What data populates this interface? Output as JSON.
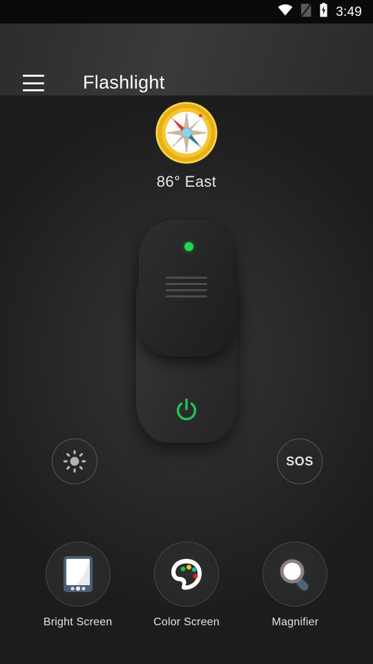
{
  "status_bar": {
    "time": "3:49",
    "icons": [
      {
        "name": "wifi-icon",
        "label": "wifi"
      },
      {
        "name": "no-sim-icon",
        "label": "no sim"
      },
      {
        "name": "battery-charging-icon",
        "label": "battery charging"
      }
    ]
  },
  "app_bar": {
    "menu_icon": "hamburger-menu-icon",
    "title": "Flashlight"
  },
  "compass": {
    "icon": "compass-icon",
    "heading_label": "86° East",
    "degrees": 86,
    "direction": "East",
    "ring_color": "#f2c230",
    "needle_north_color": "#e03a32",
    "needle_south_color": "#2d7f8c",
    "hub_color": "#8fd3e8",
    "star_color": "#c9b79c"
  },
  "flashlight": {
    "led_indicator": {
      "name": "led-indicator",
      "state": "on",
      "color": "#1fd94f"
    },
    "grip_lines": 4,
    "power_button": {
      "name": "power-button",
      "label": "Power",
      "color": "#22c55e"
    }
  },
  "side_buttons": [
    {
      "name": "brightness-button",
      "icon": "brightness-sun-icon",
      "label": ""
    },
    {
      "name": "sos-button",
      "icon": "",
      "label": "SOS"
    }
  ],
  "tools": [
    {
      "name": "bright-screen-tool",
      "icon": "phone-bright-screen-icon",
      "label": "Bright Screen",
      "accent": "#4a5f73"
    },
    {
      "name": "color-screen-tool",
      "icon": "paint-palette-icon",
      "label": "Color Screen",
      "accent": "#ffffff",
      "paint_dots": [
        "#25c05a",
        "#f2cf1e",
        "#18b5a5",
        "#e02020"
      ]
    },
    {
      "name": "magnifier-tool",
      "icon": "magnifying-glass-icon",
      "label": "Magnifier",
      "accent": "#4d6478"
    }
  ],
  "theme": {
    "background": "#262626",
    "status_bar_bg": "#0a0a0a",
    "app_bar_bg": "#333333",
    "text_primary": "#ffffff",
    "accent_green": "#22c55e"
  }
}
